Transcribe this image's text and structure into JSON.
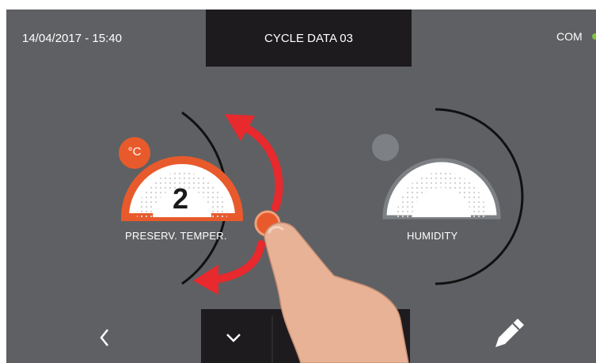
{
  "header": {
    "datetime": "14/04/2017 - 15:40",
    "title": "CYCLE DATA 03",
    "status": "COM"
  },
  "dials": [
    {
      "label": "PRESERV. TEMPER.",
      "value": "2",
      "unit": "°C",
      "active": true
    },
    {
      "label": "HUMIDITY",
      "value": "",
      "unit": "",
      "active": false
    }
  ],
  "nav": {
    "prev_icon": "chevron-left-icon",
    "down_icon": "chevron-down-icon",
    "up_icon": "chevron-up-icon",
    "edit_icon": "pencil-icon"
  },
  "colors": {
    "background": "#5f6063",
    "panel": "#1d1b1e",
    "accent": "#e85a2c",
    "status_ok": "#7cc243",
    "gesture_arrow": "#e8292d"
  }
}
